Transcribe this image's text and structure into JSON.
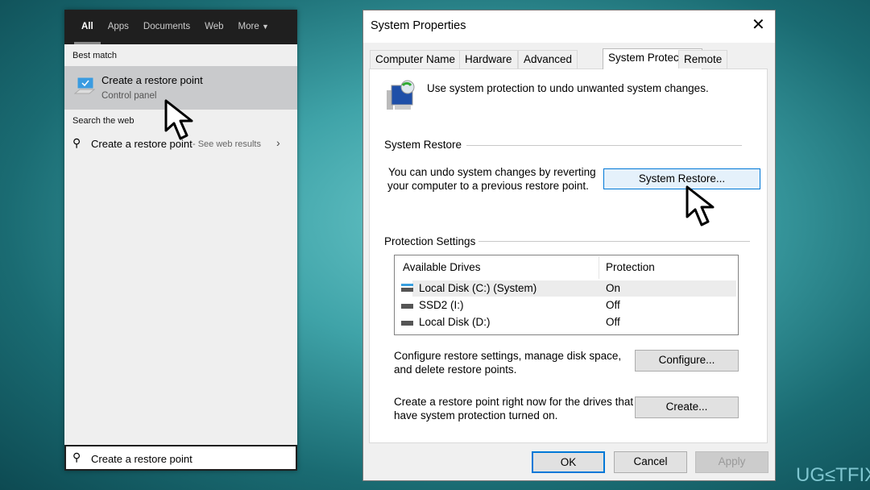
{
  "search_panel": {
    "tabs": [
      "All",
      "Apps",
      "Documents",
      "Web",
      "More"
    ],
    "best_match_label": "Best match",
    "best_match": {
      "title": "Create a restore point",
      "subtitle": "Control panel",
      "icon": "monitor-check-icon"
    },
    "search_web_label": "Search the web",
    "web_result": {
      "query": "Create a restore point",
      "suffix": "- See web results"
    },
    "search_input_value": "Create a restore point"
  },
  "dialog": {
    "title": "System Properties",
    "tabs": [
      "Computer Name",
      "Hardware",
      "Advanced",
      "System Protection",
      "Remote"
    ],
    "selected_tab": "System Protection",
    "intro": "Use system protection to undo unwanted system changes.",
    "system_restore": {
      "heading": "System Restore",
      "desc_line1": "You can undo system changes by reverting",
      "desc_line2": "your computer to a previous restore point.",
      "button": "System Restore..."
    },
    "protection": {
      "heading": "Protection Settings",
      "columns": [
        "Available Drives",
        "Protection"
      ],
      "drives": [
        {
          "name": "Local Disk (C:) (System)",
          "protection": "On"
        },
        {
          "name": "SSD2 (I:)",
          "protection": "Off"
        },
        {
          "name": "Local Disk (D:)",
          "protection": "Off"
        }
      ],
      "configure_line1": "Configure restore settings, manage disk space,",
      "configure_line2": "and delete restore points.",
      "configure_button": "Configure...",
      "create_line1": "Create a restore point right now for the drives that",
      "create_line2": "have system protection turned on.",
      "create_button": "Create..."
    },
    "buttons": {
      "ok": "OK",
      "cancel": "Cancel",
      "apply": "Apply"
    }
  },
  "watermark": "UG≤TFIX",
  "colors": {
    "accent": "#0078d7",
    "selected_button_bg": "#e5f1fb"
  }
}
